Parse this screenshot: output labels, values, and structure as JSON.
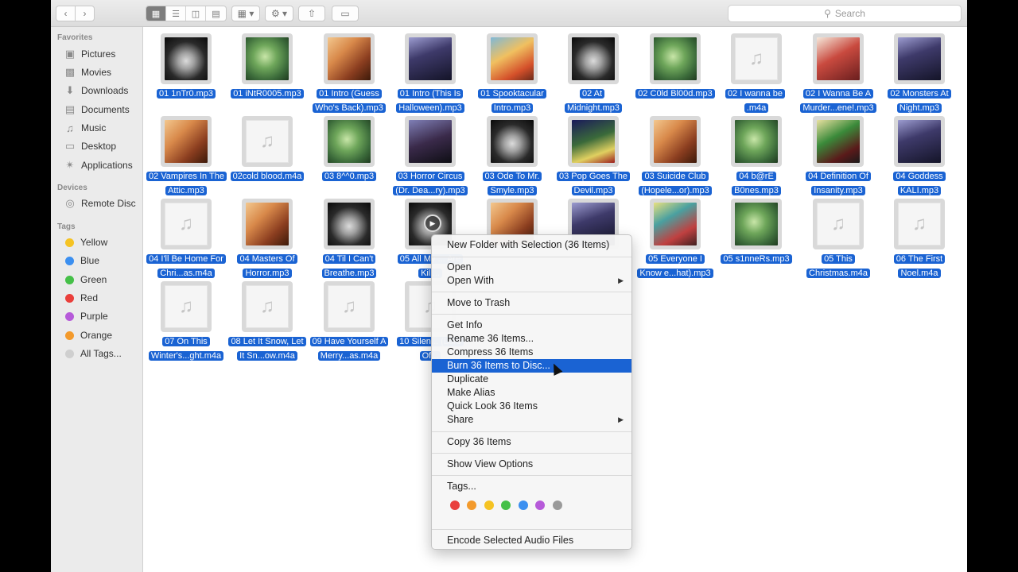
{
  "toolbar": {
    "back_icon": "chevron-left-icon",
    "forward_icon": "chevron-right-icon",
    "view_modes": [
      "icon-view-icon",
      "list-view-icon",
      "column-view-icon",
      "cover-flow-icon"
    ],
    "search_placeholder": "Search"
  },
  "sidebar": {
    "favorites_header": "Favorites",
    "favorites": [
      {
        "label": "Pictures",
        "icon": "camera-icon"
      },
      {
        "label": "Movies",
        "icon": "film-icon"
      },
      {
        "label": "Downloads",
        "icon": "download-icon"
      },
      {
        "label": "Documents",
        "icon": "document-icon"
      },
      {
        "label": "Music",
        "icon": "music-note-icon"
      },
      {
        "label": "Desktop",
        "icon": "desktop-icon"
      },
      {
        "label": "Applications",
        "icon": "applications-icon"
      }
    ],
    "devices_header": "Devices",
    "devices": [
      {
        "label": "Remote Disc",
        "icon": "disc-icon"
      }
    ],
    "tags_header": "Tags",
    "tags": [
      {
        "label": "Yellow",
        "color": "#f5c323"
      },
      {
        "label": "Blue",
        "color": "#3b8ff0"
      },
      {
        "label": "Green",
        "color": "#45c048"
      },
      {
        "label": "Red",
        "color": "#ea3f3b"
      },
      {
        "label": "Purple",
        "color": "#b65ad9"
      },
      {
        "label": "Orange",
        "color": "#f39a2c"
      },
      {
        "label": "All Tags...",
        "color": "#cfcfcf"
      }
    ]
  },
  "files": [
    [
      "01 1nTr0.mp3",
      "01 iNtR0005.mp3",
      "01 Intro (Guess Who's Back).mp3",
      "01 Intro (This Is Halloween).mp3",
      "01 Spooktacular Intro.mp3",
      "02 At Midnight.mp3",
      "02 C0ld Bl00d.mp3",
      "02 I wanna be .m4a",
      "02 I Wanna Be A Murder...ene!.mp3",
      "02 Monsters At Night.mp3"
    ],
    [
      "02 Vampires In The Attic.mp3",
      "02cold blood.m4a",
      "03 8^^0.mp3",
      "03 Horror Circus (Dr. Dea...ry).mp3",
      "03 Ode To Mr. Smyle.mp3",
      "03 Pop Goes The Devil.mp3",
      "03 Suicide Club (Hopele...or).mp3",
      "04 b@rE B0nes.mp3",
      "04 Definition Of Insanity.mp3",
      "04 Goddess KALI.mp3"
    ],
    [
      "04 I'll Be Home For Chri...as.m4a",
      "04 Masters Of Horror.mp3",
      "04 Til I Can't Breathe.mp3",
      "05 All My ... Are Kill...",
      "",
      "",
      "05 Everyone I Know e...hat).mp3",
      "05 s1nneRs.mp3",
      "05 This Christmas.m4a",
      "06 The First Noel.m4a"
    ],
    [
      "07 On This Winter's...ght.m4a",
      "08 Let It Snow, Let It Sn...ow.m4a",
      "09 Have Yourself A Merry...as.m4a",
      "10 Silen... (Lord Of..."
    ]
  ],
  "context_menu": {
    "items": [
      {
        "label": "New Folder with Selection (36 Items)"
      },
      {
        "label": "Open"
      },
      {
        "label": "Open With",
        "submenu": true
      },
      {
        "label": "Move to Trash"
      },
      {
        "label": "Get Info"
      },
      {
        "label": "Rename 36 Items..."
      },
      {
        "label": "Compress 36 Items"
      },
      {
        "label": "Burn 36 Items to Disc...",
        "highlighted": true
      },
      {
        "label": "Duplicate"
      },
      {
        "label": "Make Alias"
      },
      {
        "label": "Quick Look 36 Items"
      },
      {
        "label": "Share",
        "submenu": true
      },
      {
        "label": "Copy 36 Items"
      },
      {
        "label": "Show View Options"
      },
      {
        "label": "Tags..."
      },
      {
        "label": "Encode Selected Audio Files"
      }
    ],
    "tag_colors": [
      "#e9403d",
      "#f39a2c",
      "#f5c323",
      "#45c048",
      "#3b8ff0",
      "#b65ad9",
      "#9a9a9a"
    ]
  }
}
